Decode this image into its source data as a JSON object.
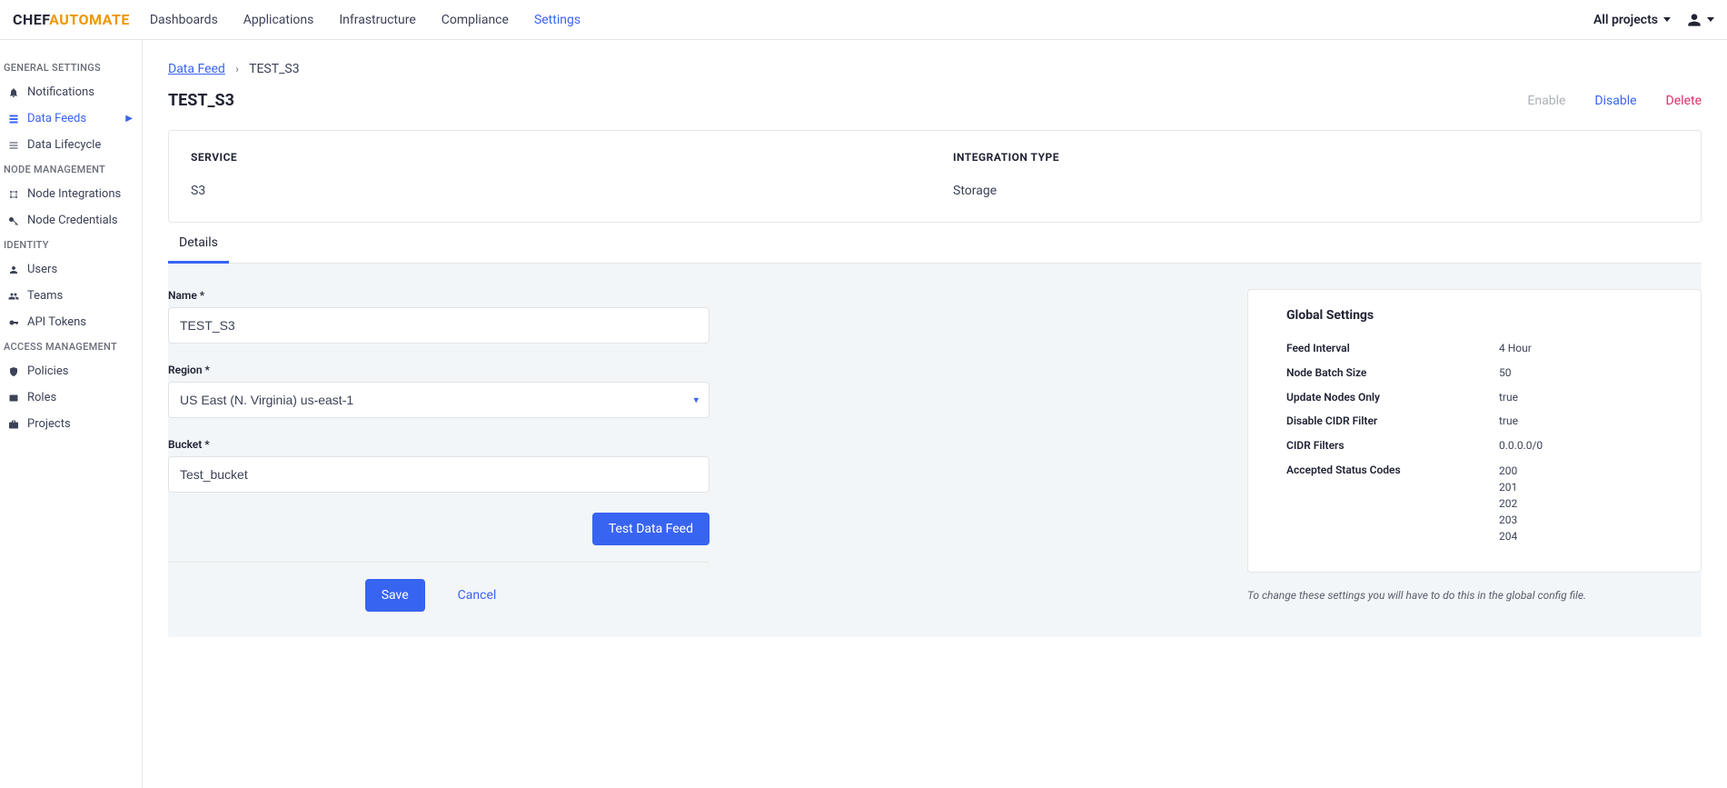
{
  "header": {
    "logo_chef": "CHEF",
    "logo_automate": "AUTOMATE",
    "nav": [
      "Dashboards",
      "Applications",
      "Infrastructure",
      "Compliance",
      "Settings"
    ],
    "nav_active": 4,
    "projects_label": "All projects"
  },
  "sidebar": {
    "groups": [
      {
        "title": "GENERAL SETTINGS",
        "items": [
          {
            "icon": "bell",
            "label": "Notifications"
          },
          {
            "icon": "feed",
            "label": "Data Feeds",
            "active": true
          },
          {
            "icon": "lifecycle",
            "label": "Data Lifecycle"
          }
        ]
      },
      {
        "title": "NODE MANAGEMENT",
        "items": [
          {
            "icon": "integrations",
            "label": "Node Integrations"
          },
          {
            "icon": "key",
            "label": "Node Credentials"
          }
        ]
      },
      {
        "title": "IDENTITY",
        "items": [
          {
            "icon": "user",
            "label": "Users"
          },
          {
            "icon": "team",
            "label": "Teams"
          },
          {
            "icon": "token",
            "label": "API Tokens"
          }
        ]
      },
      {
        "title": "ACCESS MANAGEMENT",
        "items": [
          {
            "icon": "policy",
            "label": "Policies"
          },
          {
            "icon": "role",
            "label": "Roles"
          },
          {
            "icon": "project",
            "label": "Projects"
          }
        ]
      }
    ]
  },
  "breadcrumb": {
    "root": "Data Feed",
    "current": "TEST_S3"
  },
  "page": {
    "title": "TEST_S3",
    "actions": {
      "enable": "Enable",
      "disable": "Disable",
      "delete": "Delete"
    }
  },
  "infobox": {
    "service_label": "SERVICE",
    "service_value": "S3",
    "type_label": "INTEGRATION TYPE",
    "type_value": "Storage"
  },
  "tabs": {
    "details": "Details"
  },
  "form": {
    "name_label": "Name *",
    "name_value": "TEST_S3",
    "region_label": "Region *",
    "region_value": "US East (N. Virginia) us-east-1",
    "bucket_label": "Bucket *",
    "bucket_value": "Test_bucket",
    "test_btn": "Test Data Feed",
    "save_btn": "Save",
    "cancel_btn": "Cancel"
  },
  "global": {
    "title": "Global Settings",
    "rows": [
      {
        "k": "Feed Interval",
        "v": "4 Hour"
      },
      {
        "k": "Node Batch Size",
        "v": "50"
      },
      {
        "k": "Update Nodes Only",
        "v": "true"
      },
      {
        "k": "Disable CIDR Filter",
        "v": "true"
      },
      {
        "k": "CIDR Filters",
        "v": "0.0.0.0/0"
      }
    ],
    "codes_label": "Accepted Status Codes",
    "codes": [
      "200",
      "201",
      "202",
      "203",
      "204"
    ],
    "foot": "To change these settings you will have to do this in the global config file."
  }
}
